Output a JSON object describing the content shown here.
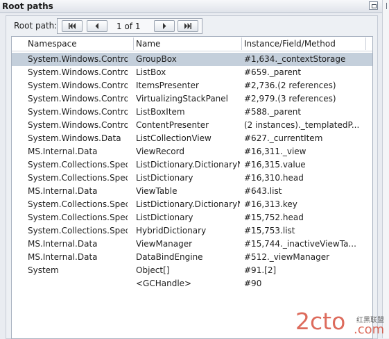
{
  "titlebar": {
    "title": "Root paths"
  },
  "toolbar": {
    "root_path_label": "Root path:",
    "first_icon": "first-page-icon",
    "prev_icon": "previous-page-icon",
    "page_info": "1 of 1",
    "next_icon": "next-page-icon",
    "last_icon": "last-page-icon"
  },
  "table": {
    "columns": [
      "Namespace",
      "Name",
      "Instance/Field/Method"
    ],
    "rows": [
      [
        "System.Windows.Controls",
        "GroupBox",
        "#1,634._contextStorage"
      ],
      [
        "System.Windows.Controls",
        "ListBox",
        "#659._parent"
      ],
      [
        "System.Windows.Controls",
        "ItemsPresenter",
        "#2,736.(2 references)"
      ],
      [
        "System.Windows.Controls",
        "VirtualizingStackPanel",
        "#2,979.(3 references)"
      ],
      [
        "System.Windows.Controls",
        "ListBoxItem",
        "#588._parent"
      ],
      [
        "System.Windows.Controls",
        "ContentPresenter",
        "(2 instances)._templatedP..."
      ],
      [
        "System.Windows.Data",
        "ListCollectionView",
        "#627._currentItem"
      ],
      [
        "MS.Internal.Data",
        "ViewRecord",
        "#16,311._view"
      ],
      [
        "System.Collections.Speci...",
        "ListDictionary.DictionaryN...",
        "#16,315.value"
      ],
      [
        "System.Collections.Speci...",
        "ListDictionary",
        "#16,310.head"
      ],
      [
        "MS.Internal.Data",
        "ViewTable",
        "#643.list"
      ],
      [
        "System.Collections.Speci...",
        "ListDictionary.DictionaryN...",
        "#16,313.key"
      ],
      [
        "System.Collections.Speci...",
        "ListDictionary",
        "#15,752.head"
      ],
      [
        "System.Collections.Speci...",
        "HybridDictionary",
        "#15,753.list"
      ],
      [
        "MS.Internal.Data",
        "ViewManager",
        "#15,744._inactiveViewTa..."
      ],
      [
        "MS.Internal.Data",
        "DataBindEngine",
        "#512._viewManager"
      ],
      [
        "System",
        "Object[]",
        "#91.[2]"
      ],
      [
        "",
        "<GCHandle>",
        "#90"
      ]
    ],
    "selected_row": 0
  },
  "watermark": {
    "text_main": "2cto",
    "text_com": ".com",
    "text_cn": "红黑联盟"
  },
  "colors": {
    "selection": "#c4cfdb",
    "watermark": "#d23a26"
  }
}
